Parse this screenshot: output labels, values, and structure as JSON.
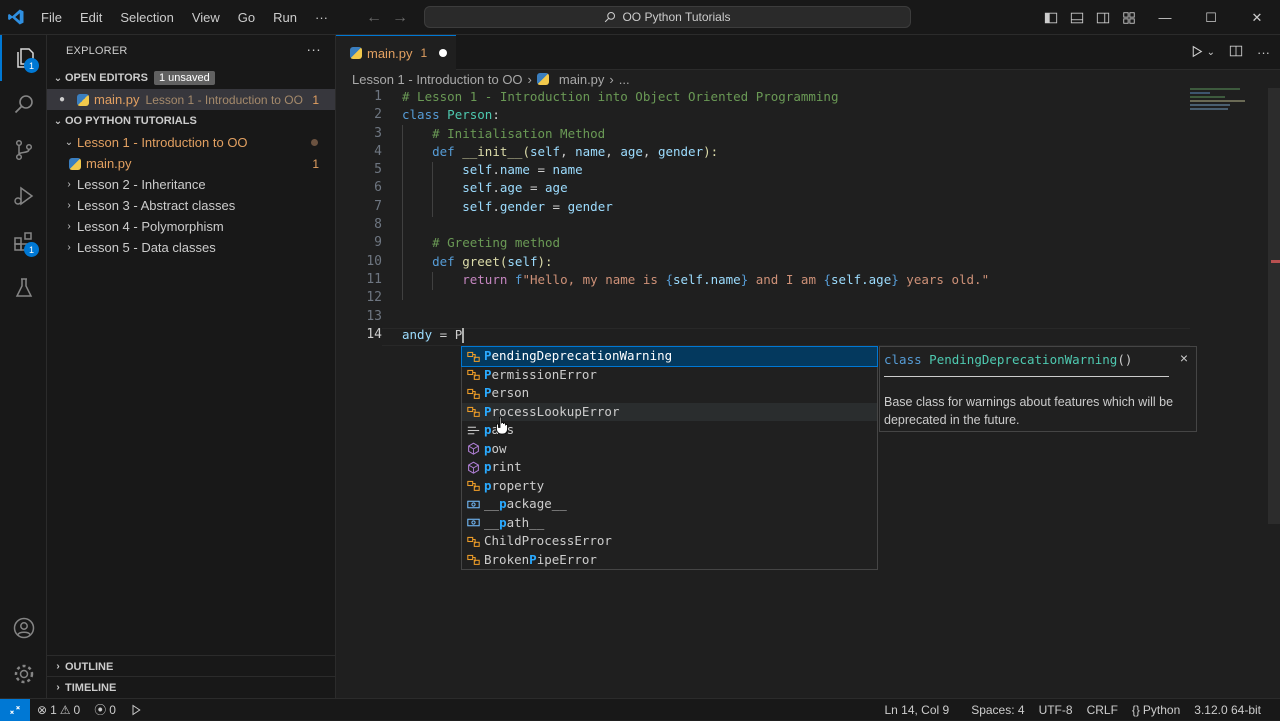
{
  "menu": [
    "File",
    "Edit",
    "Selection",
    "View",
    "Go",
    "Run",
    "···"
  ],
  "command_center": "OO Python Tutorials",
  "activity": {
    "explorer_badge": "1",
    "extensions_badge": "1"
  },
  "sidebar": {
    "title": "EXPLORER",
    "more": "···",
    "open_editors": {
      "label": "OPEN EDITORS",
      "tag": "1 unsaved",
      "item": {
        "name": "main.py",
        "path": "Lesson 1 - Introduction to OO",
        "count": "1"
      }
    },
    "workspace": {
      "label": "OO PYTHON TUTORIALS",
      "folder_open": "Lesson 1 - Introduction to OO",
      "file": {
        "name": "main.py",
        "count": "1"
      },
      "folders": [
        "Lesson 2 - Inheritance",
        "Lesson 3 - Abstract classes",
        "Lesson 4 - Polymorphism",
        "Lesson 5 - Data classes"
      ]
    },
    "outline": "OUTLINE",
    "timeline": "TIMELINE"
  },
  "tab": {
    "name": "main.py",
    "count": "1"
  },
  "breadcrumb": {
    "folder": "Lesson 1 - Introduction to OO",
    "file": "main.py",
    "more": "..."
  },
  "line_numbers": [
    "1",
    "2",
    "3",
    "4",
    "5",
    "6",
    "7",
    "8",
    "9",
    "10",
    "11",
    "12",
    "13",
    "14"
  ],
  "code": {
    "l1": "# Lesson 1 - Introduction into Object Oriented Programming",
    "l2_kw": "class",
    "l2_name": "Person",
    "l2_end": ":",
    "l3": "# Initialisation Method",
    "l4_kw": "def",
    "l4_fn": "__init__",
    "l4_a": "(",
    "l4_p1": "self",
    "l4_c1": ", ",
    "l4_p2": "name",
    "l4_c2": ", ",
    "l4_p3": "age",
    "l4_c3": ", ",
    "l4_p4": "gender",
    "l4_end": "):",
    "l5_a": "self",
    "l5_b": ".",
    "l5_c": "name",
    "l5_d": " = ",
    "l5_e": "name",
    "l6_a": "self",
    "l6_b": ".",
    "l6_c": "age",
    "l6_d": " = ",
    "l6_e": "age",
    "l7_a": "self",
    "l7_b": ".",
    "l7_c": "gender",
    "l7_d": " = ",
    "l7_e": "gender",
    "l9": "# Greeting method",
    "l10_kw": "def",
    "l10_fn": "greet",
    "l10_a": "(",
    "l10_p": "self",
    "l10_end": "):",
    "l11_ret": "return",
    "l11_f": "f",
    "l11_s1": "\"Hello, my name is ",
    "l11_b1": "{",
    "l11_v1": "self.name",
    "l11_b2": "}",
    "l11_s2": " and I am ",
    "l11_b3": "{",
    "l11_v2": "self.age",
    "l11_b4": "}",
    "l11_s3": " years old.\"",
    "l14_var": "andy",
    "l14_op": " = ",
    "l14_typed": "P"
  },
  "suggestions": [
    {
      "kind": "class",
      "hl": "P",
      "rest": "endingDeprecationWarning"
    },
    {
      "kind": "class",
      "hl": "P",
      "rest": "ermissionError"
    },
    {
      "kind": "class",
      "hl": "P",
      "rest": "erson"
    },
    {
      "kind": "class",
      "hl": "P",
      "rest": "rocessLookupError"
    },
    {
      "kind": "text",
      "hl": "p",
      "rest": "ass"
    },
    {
      "kind": "func",
      "hl": "p",
      "rest": "ow"
    },
    {
      "kind": "func",
      "hl": "p",
      "rest": "rint"
    },
    {
      "kind": "class",
      "hl": "p",
      "rest": "roperty"
    },
    {
      "kind": "var",
      "pre": "__",
      "hl": "p",
      "rest": "ackage__"
    },
    {
      "kind": "var",
      "pre": "__",
      "hl": "p",
      "rest": "ath__"
    },
    {
      "kind": "class",
      "pre": "ChildProcess",
      "hl": "",
      "rest": "Error"
    },
    {
      "kind": "class",
      "pre": "Broken",
      "hl": "P",
      "rest": "ipeError"
    }
  ],
  "details": {
    "kw": "class",
    "name": "PendingDeprecationWarning",
    "sig_end": "()",
    "doc": "Base class for warnings about features which will be deprecated in the future.",
    "close": "×"
  },
  "status": {
    "errors": "1",
    "warnings": "0",
    "ports": "0",
    "position": "Ln 14, Col 9",
    "spaces": "Spaces: 4",
    "encoding": "UTF-8",
    "eol": "CRLF",
    "language": "Python",
    "interpreter": "3.12.0 64-bit"
  },
  "colors": {
    "accent": "#0078d4",
    "modified": "#e2a061",
    "match_highlight": "#2aaaff"
  }
}
